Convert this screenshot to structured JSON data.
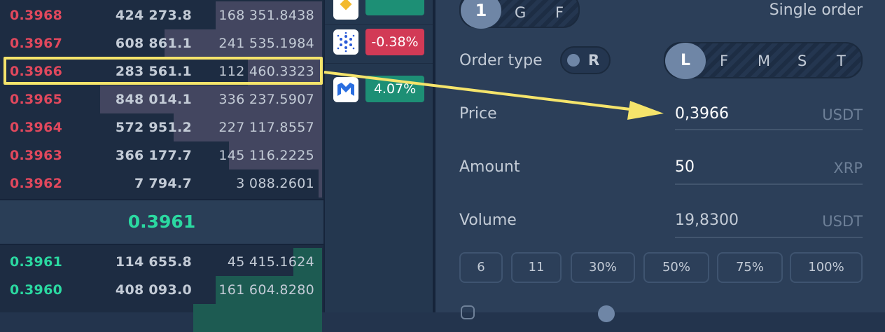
{
  "orderbook": {
    "asks": [
      {
        "price": "0.3968",
        "qty": "424 273.8",
        "total": "168 351.8438",
        "depth": 0.33
      },
      {
        "price": "0.3967",
        "qty": "608 861.1",
        "total": "241 535.1984",
        "depth": 0.49
      },
      {
        "price": "0.3966",
        "qty": "283 561.1",
        "total": "112 460.3323",
        "depth": 0.23
      },
      {
        "price": "0.3965",
        "qty": "848 014.1",
        "total": "336 237.5907",
        "depth": 0.69
      },
      {
        "price": "0.3964",
        "qty": "572 951.2",
        "total": "227 117.8557",
        "depth": 0.46
      },
      {
        "price": "0.3963",
        "qty": "366 177.7",
        "total": "145 116.2225",
        "depth": 0.29
      },
      {
        "price": "0.3962",
        "qty": "7 794.7",
        "total": "3 088.2601",
        "depth": 0.01
      }
    ],
    "last_price": "0.3961",
    "bids": [
      {
        "price": "0.3961",
        "qty": "114 655.8",
        "total": "45 415.1624",
        "depth": 0.09
      },
      {
        "price": "0.3960",
        "qty": "408 093.0",
        "total": "161 604.8280",
        "depth": 0.33
      },
      {
        "price": "",
        "qty": "",
        "total": "",
        "depth": 0.4
      }
    ],
    "highlighted_row": 2
  },
  "markets": [
    {
      "icon": "bnb-icon",
      "change": "",
      "color": "#1d8f75"
    },
    {
      "icon": "cardano-icon",
      "change": "-0.38%",
      "color": "#d23a56"
    },
    {
      "icon": "polygon-icon",
      "change": "4.07%",
      "color": "#1d8f75"
    }
  ],
  "panel": {
    "leverage_options": [
      "1",
      "G",
      "F"
    ],
    "leverage_selected": "1",
    "mode_label": "Single order",
    "order_type_label": "Order type",
    "order_type_toggle": "R",
    "order_kinds": [
      "L",
      "F",
      "M",
      "S",
      "T"
    ],
    "order_kind_selected": "L",
    "price": {
      "label": "Price",
      "value": "0,3966",
      "unit": "USDT"
    },
    "amount": {
      "label": "Amount",
      "value": "50",
      "unit": "XRP"
    },
    "volume": {
      "label": "Volume",
      "value": "19,8300",
      "unit": "USDT"
    },
    "quick_buttons": [
      "6",
      "11",
      "30%",
      "50%",
      "75%",
      "100%"
    ]
  },
  "colors": {
    "ask": "#e0485d",
    "bid": "#2bd9a1",
    "highlight": "#f5e46b",
    "background": "#23344d"
  }
}
